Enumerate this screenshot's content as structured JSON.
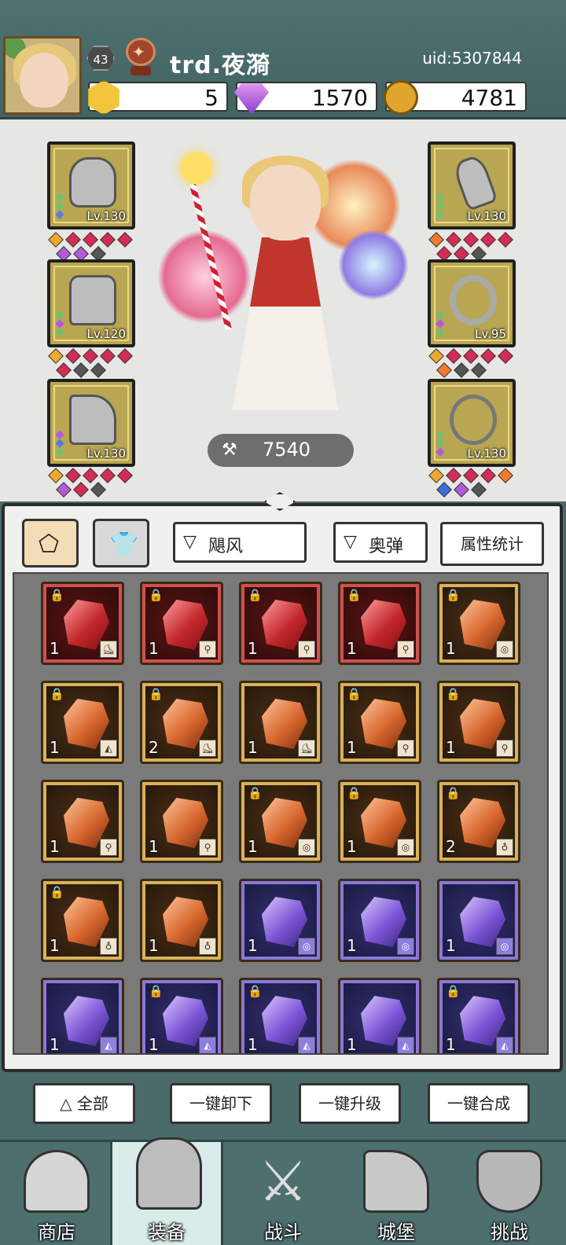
{
  "player": {
    "level": "43",
    "name": "trd.夜漪",
    "uid": "uid:5307844"
  },
  "currencies": {
    "gold_hex": "5",
    "gem": "1570",
    "coin": "4781"
  },
  "equipment": {
    "left": [
      {
        "name": "hood",
        "level": "Lv.130"
      },
      {
        "name": "cape",
        "level": "Lv.120"
      },
      {
        "name": "boots",
        "level": "Lv.130"
      }
    ],
    "right": [
      {
        "name": "staff",
        "level": "Lv.130"
      },
      {
        "name": "ring",
        "level": "Lv.95"
      },
      {
        "name": "necklace",
        "level": "Lv.130"
      }
    ]
  },
  "power": "7540",
  "filters": {
    "filter1": "飓风",
    "filter2": "奥弹",
    "stats_button": "属性统计"
  },
  "inventory": [
    {
      "color": "red",
      "count": "1",
      "locked": true,
      "slot": "boot"
    },
    {
      "color": "red",
      "count": "1",
      "locked": true,
      "slot": "staff"
    },
    {
      "color": "red",
      "count": "1",
      "locked": true,
      "slot": "staff"
    },
    {
      "color": "red",
      "count": "1",
      "locked": true,
      "slot": "staff"
    },
    {
      "color": "orange",
      "count": "1",
      "locked": true,
      "slot": "ring"
    },
    {
      "color": "orange",
      "count": "1",
      "locked": true,
      "slot": "cape"
    },
    {
      "color": "orange",
      "count": "2",
      "locked": true,
      "slot": "boot"
    },
    {
      "color": "orange",
      "count": "1",
      "locked": false,
      "slot": "boot"
    },
    {
      "color": "orange",
      "count": "1",
      "locked": true,
      "slot": "staff"
    },
    {
      "color": "orange",
      "count": "1",
      "locked": true,
      "slot": "staff"
    },
    {
      "color": "orange",
      "count": "1",
      "locked": false,
      "slot": "staff"
    },
    {
      "color": "orange",
      "count": "1",
      "locked": false,
      "slot": "staff"
    },
    {
      "color": "orange",
      "count": "1",
      "locked": true,
      "slot": "ring"
    },
    {
      "color": "orange",
      "count": "1",
      "locked": true,
      "slot": "ring"
    },
    {
      "color": "orange",
      "count": "2",
      "locked": true,
      "slot": "necklace"
    },
    {
      "color": "orange",
      "count": "1",
      "locked": true,
      "slot": "necklace"
    },
    {
      "color": "orange",
      "count": "1",
      "locked": false,
      "slot": "necklace"
    },
    {
      "color": "purple",
      "count": "1",
      "locked": false,
      "slot": "ring"
    },
    {
      "color": "purple",
      "count": "1",
      "locked": false,
      "slot": "ring"
    },
    {
      "color": "purple",
      "count": "1",
      "locked": false,
      "slot": "ring"
    },
    {
      "color": "purple",
      "count": "1",
      "locked": false,
      "slot": "cape"
    },
    {
      "color": "purple",
      "count": "1",
      "locked": true,
      "slot": "cape"
    },
    {
      "color": "purple",
      "count": "1",
      "locked": true,
      "slot": "cape"
    },
    {
      "color": "purple",
      "count": "1",
      "locked": false,
      "slot": "cape"
    },
    {
      "color": "purple",
      "count": "1",
      "locked": true,
      "slot": "cape"
    }
  ],
  "actions": {
    "all": "全部",
    "unequip": "一键卸下",
    "upgrade": "一键升级",
    "merge": "一键合成"
  },
  "nav": [
    {
      "label": "商店"
    },
    {
      "label": "装备"
    },
    {
      "label": "战斗"
    },
    {
      "label": "城堡"
    },
    {
      "label": "挑战"
    }
  ]
}
